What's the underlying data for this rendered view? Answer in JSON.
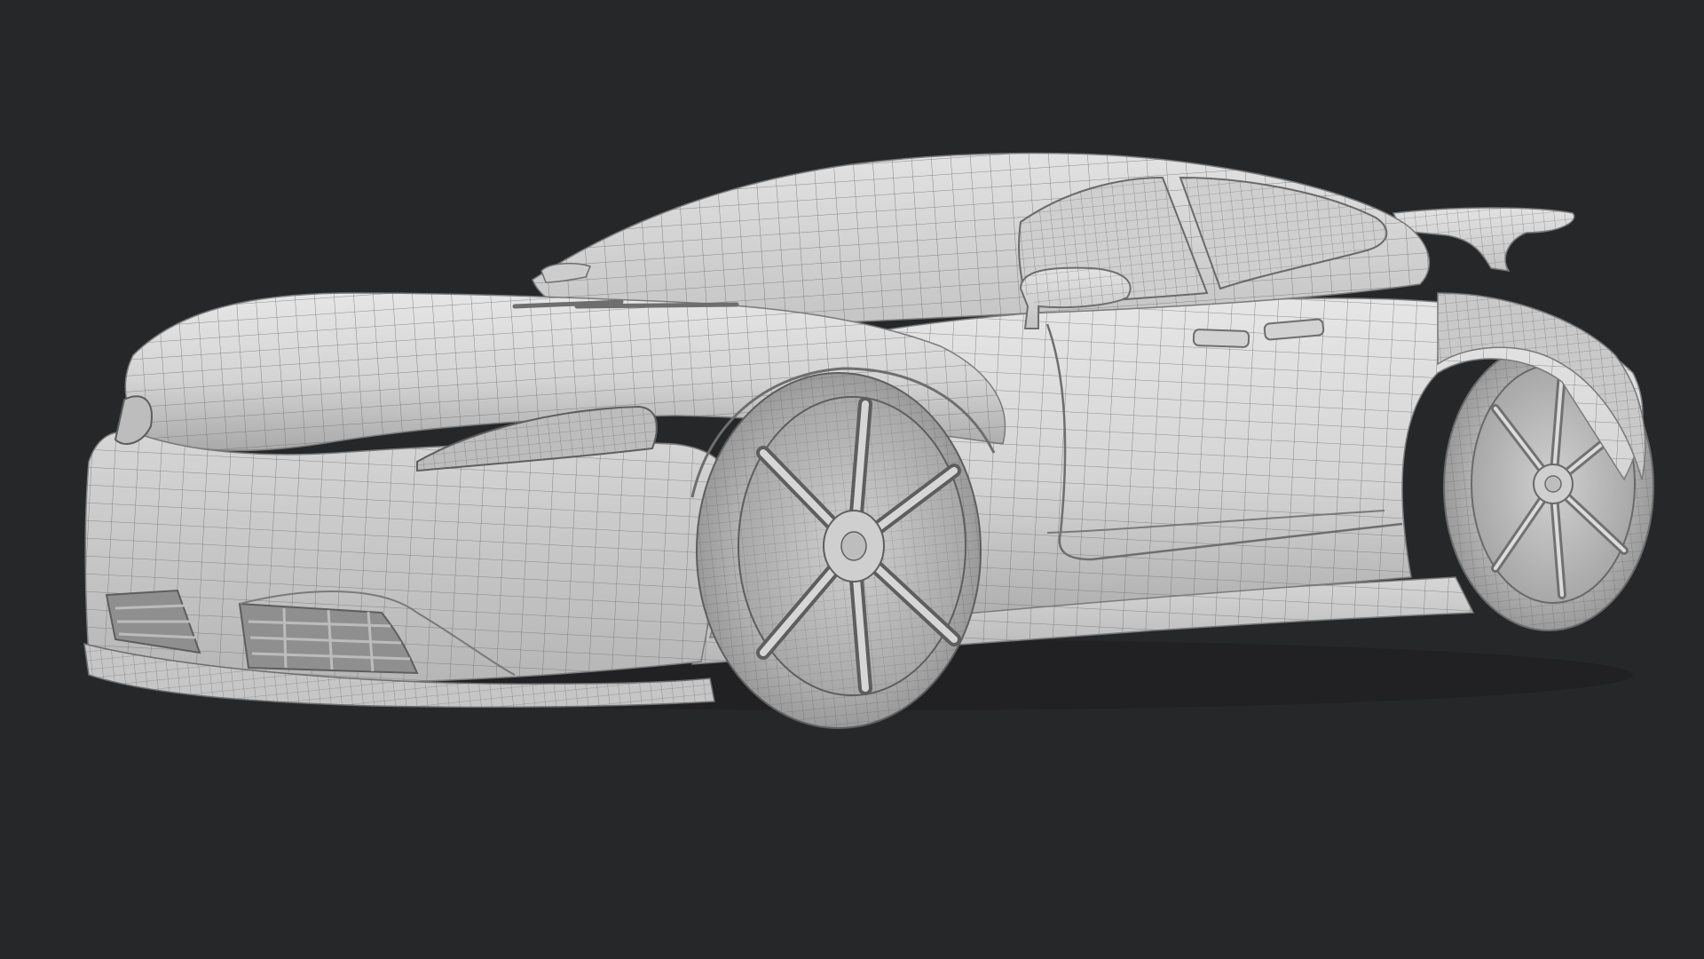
{
  "scene": {
    "subject": "car-wireframe-render",
    "background_color": "#262729",
    "body_color": "#d8d8d8",
    "wire_color": "#6e6e6e",
    "shadow_color": "#9a9a9a"
  }
}
